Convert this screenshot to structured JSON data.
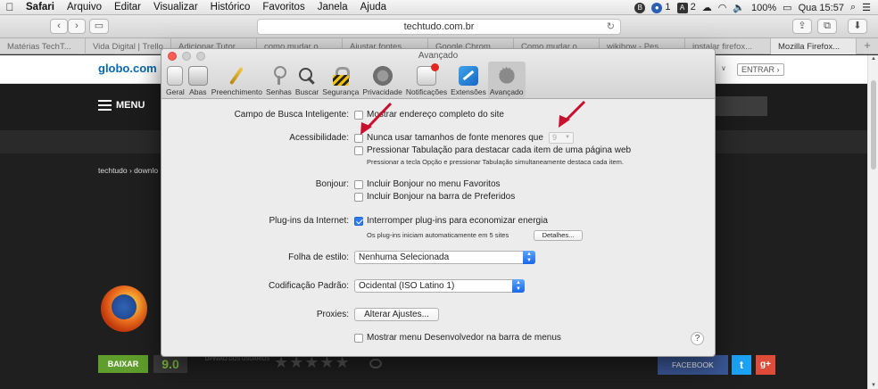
{
  "menubar": {
    "apple": "",
    "items": [
      "Safari",
      "Arquivo",
      "Editar",
      "Visualizar",
      "Histórico",
      "Favoritos",
      "Janela",
      "Ajuda"
    ],
    "tray": {
      "badge1": "1",
      "badge2": "2",
      "battery": "100%",
      "clock": "Qua 15:57"
    }
  },
  "toolbar": {
    "url": "techtudo.com.br"
  },
  "tabs": [
    "Matérias TechT...",
    "Vida Digital | Trello",
    "Adicionar Tutor...",
    "como mudar o...",
    "Ajustar fontes...",
    "Google Chrom...",
    "Como mudar o...",
    "wikihow - Pes...",
    "instalar firefox...",
    "Mozilla Firefox..."
  ],
  "webpage": {
    "logo": "globo.com",
    "entrar": "ENTRAR ›",
    "menu": "MENU",
    "breadcrumb": "techtudo › downlo",
    "baixar": "BAIXAR",
    "score": "9.0",
    "opiniao": "OPINIÃO DOS USUÁRIOS",
    "stars": "★★★★★",
    "facebook": "FACEBOOK",
    "twitter": "t",
    "gplus": "g+"
  },
  "prefs": {
    "title": "Avançado",
    "toolbar": [
      {
        "label": "Geral",
        "icon": "geral"
      },
      {
        "label": "Abas",
        "icon": "abas"
      },
      {
        "label": "Preenchimento",
        "icon": "pre"
      },
      {
        "label": "Senhas",
        "icon": "senhas"
      },
      {
        "label": "Buscar",
        "icon": "buscar"
      },
      {
        "label": "Segurança",
        "icon": "seg"
      },
      {
        "label": "Privacidade",
        "icon": "priv"
      },
      {
        "label": "Notificações",
        "icon": "notif"
      },
      {
        "label": "Extensões",
        "icon": "ext"
      },
      {
        "label": "Avançado",
        "icon": "avan"
      }
    ],
    "campo_busca_label": "Campo de Busca Inteligente:",
    "campo_busca_opt": "Mostrar endereço completo do site",
    "acess_label": "Acessibilidade:",
    "acess_opt1": "Nunca usar tamanhos de fonte menores que",
    "acess_fontsize": "9",
    "acess_opt2": "Pressionar Tabulação para destacar cada item de uma página web",
    "acess_note": "Pressionar a tecla Opção e pressionar Tabulação simultaneamente destaca cada item.",
    "bonjour_label": "Bonjour:",
    "bonjour_opt1": "Incluir Bonjour no menu Favoritos",
    "bonjour_opt2": "Incluir Bonjour na barra de Preferidos",
    "plugins_label": "Plug-ins da Internet:",
    "plugins_opt": "Interromper plug-ins para economizar energia",
    "plugins_note": "Os plug-ins iniciam automaticamente em 5 sites",
    "plugins_btn": "Detalhes...",
    "folha_label": "Folha de estilo:",
    "folha_value": "Nenhuma Selecionada",
    "cod_label": "Codificação Padrão:",
    "cod_value": "Ocidental (ISO Latino 1)",
    "proxies_label": "Proxies:",
    "proxies_btn": "Alterar Ajustes...",
    "dev_opt": "Mostrar menu Desenvolvedor na barra de menus",
    "help": "?"
  },
  "colors": {
    "annotation_arrow": "#c8102e",
    "accent_blue": "#2e7cf6"
  }
}
